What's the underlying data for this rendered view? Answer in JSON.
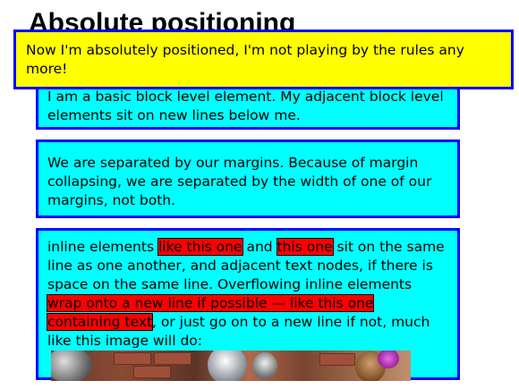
{
  "heading": "Absolute positioning",
  "absolute_box": {
    "text": "Now I'm absolutely positioned, I'm not playing by the rules any more!"
  },
  "paragraph1": {
    "text": "I am a basic block level element. My adjacent block level elements sit on new lines below me."
  },
  "paragraph2": {
    "text": "We are separated by our margins. Because of margin collapsing, we are separated by the width of one of our margins, not both."
  },
  "paragraph3": {
    "part1": "inline elements ",
    "span1": "like this one",
    "part2": " and ",
    "span2": "this one",
    "part3": " sit on the same line as one another, and adjacent text nodes, if there is space on the same line. Overflowing inline elements ",
    "span3": "wrap onto a new line if possible — like this one containing text",
    "part4": ", or just go on to a new line if not, much like this image will do: "
  },
  "image": {
    "icon": "photo-image"
  },
  "colors": {
    "block_bg": "#00ffff",
    "block_border": "#0000ff",
    "absolute_bg": "#ffff00",
    "highlight": "#ff0000"
  }
}
